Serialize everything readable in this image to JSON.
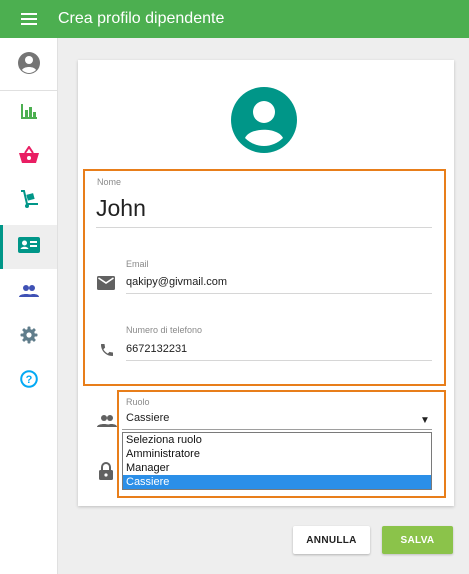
{
  "appbar": {
    "title": "Crea profilo dipendente",
    "icon": "menu-icon"
  },
  "sidebar": {
    "items": [
      {
        "name": "account-circle-icon",
        "color": "#757575"
      },
      {
        "name": "bar-chart-icon",
        "color": "#4caf50"
      },
      {
        "name": "shopping-basket-icon",
        "color": "#e91e63"
      },
      {
        "name": "hand-truck-icon",
        "color": "#009688"
      },
      {
        "name": "contact-card-icon",
        "color": "#009688",
        "active": true
      },
      {
        "name": "people-icon",
        "color": "#3f51b5"
      },
      {
        "name": "settings-gear-icon",
        "color": "#607d8b"
      },
      {
        "name": "help-circle-icon",
        "color": "#03a9f4"
      }
    ]
  },
  "form": {
    "avatar_color": "#009688",
    "name": {
      "label": "Nome",
      "value": "John"
    },
    "email": {
      "label": "Email",
      "value": "qakipy@givmail.com"
    },
    "phone": {
      "label": "Numero di telefono",
      "value": "6672132231"
    },
    "role": {
      "label": "Ruolo",
      "value": "Cassiere",
      "options": [
        "Seleziona ruolo",
        "Amministratore",
        "Manager",
        "Cassiere"
      ],
      "selected_index": 3
    }
  },
  "actions": {
    "cancel_label": "ANNULLA",
    "save_label": "SALVA"
  },
  "colors": {
    "appbar": "#4caf50",
    "highlight": "#e87e1a",
    "save": "#8bc34a",
    "option_selected": "#2b8fe8"
  }
}
